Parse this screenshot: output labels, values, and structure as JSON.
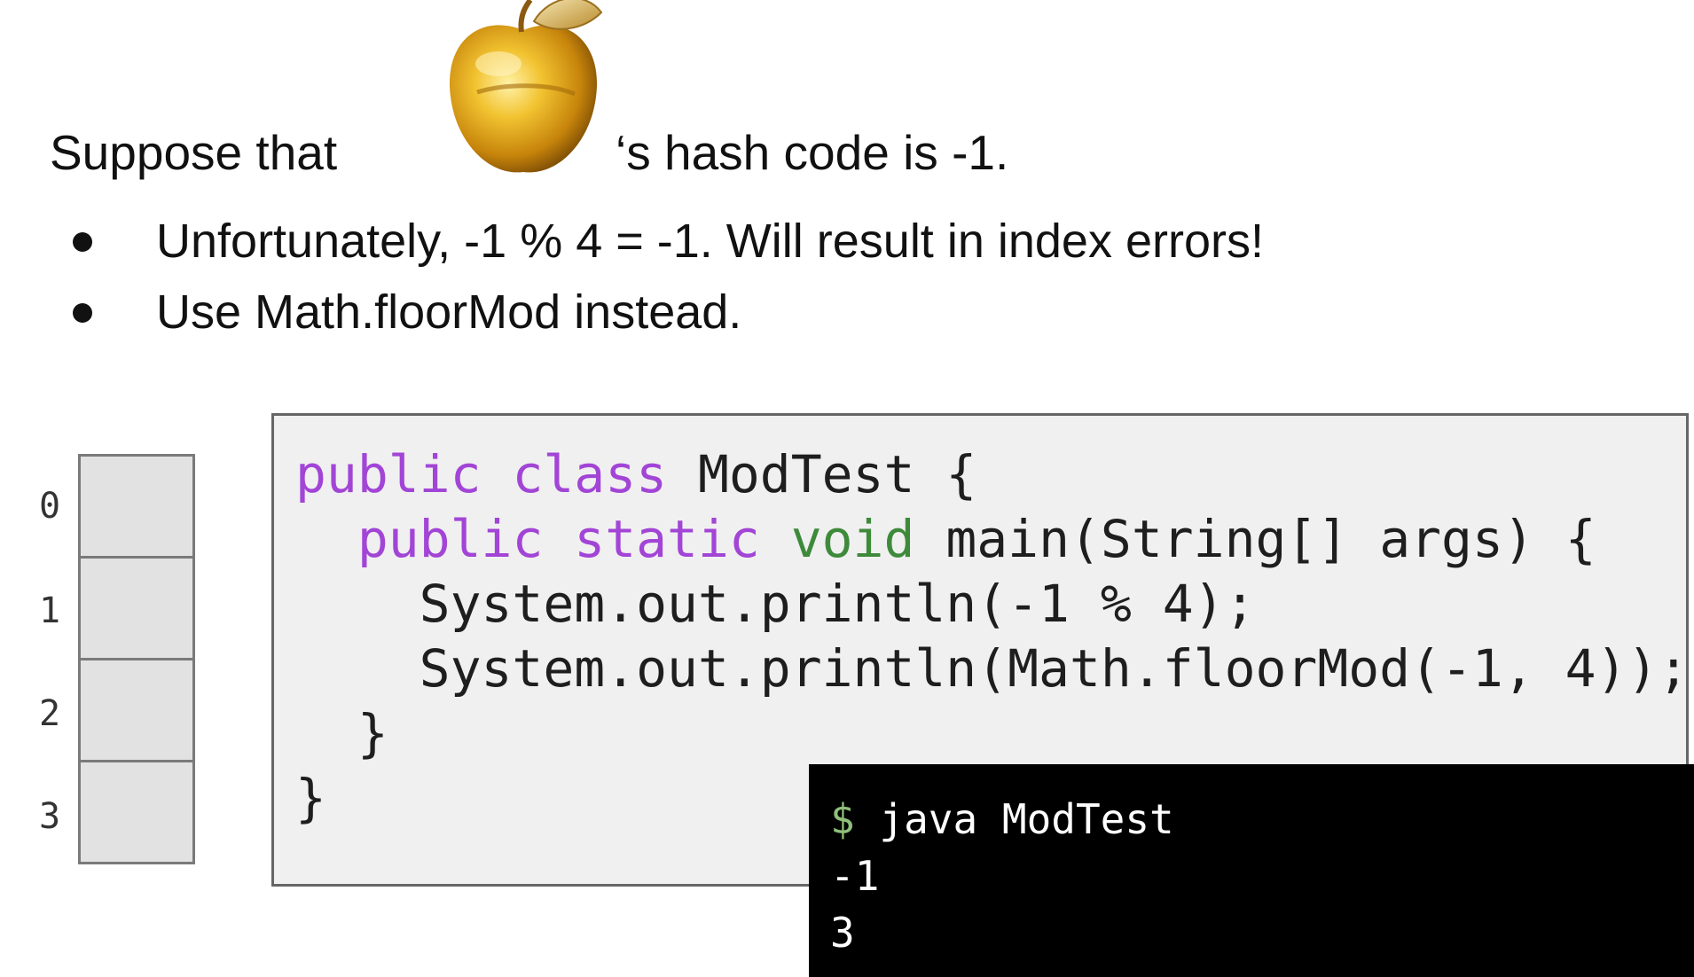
{
  "title": {
    "prefix": "Suppose that",
    "suffix": "‘s hash code is -1."
  },
  "bullets": [
    "Unfortunately, -1 % 4 = -1. Will result in index errors!",
    "Use Math.floorMod instead."
  ],
  "array": {
    "indices": [
      "0",
      "1",
      "2",
      "3"
    ]
  },
  "code": {
    "line1": {
      "kw1": "public",
      "kw2": "class",
      "rest": " ModTest {"
    },
    "line2": {
      "indent": "  ",
      "kw1": "public",
      "kw2": "static",
      "type": "void",
      "rest": " main(String[] args) {"
    },
    "line3": "    System.out.println(-1 % 4);",
    "line4": "    System.out.println(Math.floorMod(-1, 4));",
    "line5": "  }",
    "line6": "}"
  },
  "terminal": {
    "prompt": "$",
    "command": " java ModTest",
    "output1": "-1",
    "output2": "3"
  },
  "colors": {
    "keyword": "#a245d6",
    "type": "#3e8a3b",
    "prompt": "#8fbf7a"
  },
  "icons": {
    "apple": "golden-apple-icon"
  }
}
